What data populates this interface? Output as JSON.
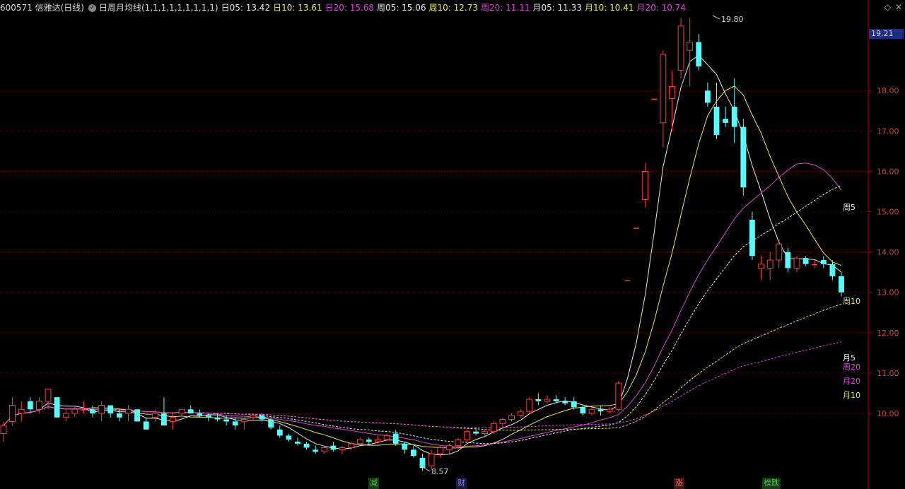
{
  "header": {
    "stock": "600571 信雅达(日线)",
    "indicator": "日周月均线(1,1,1,1,1,1,1,1,1)",
    "values": [
      {
        "label": "日05: 13.42",
        "color": "#e8e8e8"
      },
      {
        "label": "日10: 13.61",
        "color": "#e8e850"
      },
      {
        "label": "日20: 15.68",
        "color": "#e040e0"
      },
      {
        "label": "周05: 15.06",
        "color": "#e8e8e8"
      },
      {
        "label": "周10: 12.73",
        "color": "#e8e850"
      },
      {
        "label": "周20: 11.11",
        "color": "#e040e0"
      },
      {
        "label": "月05: 11.33",
        "color": "#e8e8e8"
      },
      {
        "label": "月10: 10.41",
        "color": "#e8e850"
      },
      {
        "label": "月20: 10.74",
        "color": "#e040e0"
      }
    ]
  },
  "window_icons": [
    "diamond-icon",
    "close-icon"
  ],
  "price_axis": {
    "ticks": [
      "18.00",
      "17.00",
      "16.00",
      "15.00",
      "14.00",
      "13.00",
      "12.00",
      "11.00",
      "10.00"
    ],
    "current_price": "19.21"
  },
  "annotations": {
    "high": "19.80",
    "low": "8.57"
  },
  "legend": [
    {
      "label": "周5",
      "color": "#e8e8e8"
    },
    {
      "label": "周10",
      "color": "#e8e850"
    },
    {
      "label": "月5",
      "color": "#e8e8e8"
    },
    {
      "label": "周20",
      "color": "#e040e0"
    },
    {
      "label": "月20",
      "color": "#e040e0"
    },
    {
      "label": "月10",
      "color": "#e8e850"
    }
  ],
  "events": [
    {
      "label": "减",
      "color": "#3cc83c",
      "bg": "#1a3a1a"
    },
    {
      "label": "财",
      "color": "#8080ff",
      "bg": "#1a1a40"
    },
    {
      "label": "涨",
      "color": "#ff6060",
      "bg": "#401818"
    },
    {
      "label": "榜跌",
      "color": "#3cc83c",
      "bg": "#1a3a1a"
    }
  ],
  "colors": {
    "up": "#ff3c3c",
    "down": "#54ffff",
    "grid": "#8c0000",
    "axis": "#b00000"
  },
  "chart_data": {
    "type": "candlestick",
    "y_range": [
      8.2,
      20.0
    ],
    "daily_ohlc_approx": [
      {
        "o": 9.5,
        "h": 9.8,
        "l": 9.3,
        "c": 9.7
      },
      {
        "o": 9.8,
        "h": 10.4,
        "l": 9.7,
        "c": 10.2
      },
      {
        "o": 10.0,
        "h": 10.3,
        "l": 9.8,
        "c": 10.1
      },
      {
        "o": 10.3,
        "h": 10.4,
        "l": 10.0,
        "c": 10.1
      },
      {
        "o": 10.1,
        "h": 10.4,
        "l": 10.0,
        "c": 10.3
      },
      {
        "o": 10.3,
        "h": 10.6,
        "l": 10.1,
        "c": 10.6
      },
      {
        "o": 10.4,
        "h": 10.4,
        "l": 9.9,
        "c": 9.9
      },
      {
        "o": 9.9,
        "h": 10.1,
        "l": 9.8,
        "c": 10.0
      },
      {
        "o": 10.0,
        "h": 10.2,
        "l": 9.9,
        "c": 10.1
      },
      {
        "o": 10.1,
        "h": 10.3,
        "l": 10.0,
        "c": 10.1
      },
      {
        "o": 10.1,
        "h": 10.2,
        "l": 9.9,
        "c": 10.0
      },
      {
        "o": 10.0,
        "h": 10.3,
        "l": 9.8,
        "c": 10.2
      },
      {
        "o": 10.2,
        "h": 10.2,
        "l": 9.9,
        "c": 10.0
      },
      {
        "o": 10.0,
        "h": 10.1,
        "l": 9.8,
        "c": 9.9
      },
      {
        "o": 10.0,
        "h": 10.2,
        "l": 9.8,
        "c": 10.1
      },
      {
        "o": 10.1,
        "h": 10.1,
        "l": 9.8,
        "c": 9.8
      },
      {
        "o": 9.8,
        "h": 9.9,
        "l": 9.6,
        "c": 9.6
      },
      {
        "o": 9.9,
        "h": 10.1,
        "l": 9.8,
        "c": 10.0
      },
      {
        "o": 10.0,
        "h": 10.4,
        "l": 9.8,
        "c": 9.7
      },
      {
        "o": 9.8,
        "h": 10.0,
        "l": 9.6,
        "c": 9.9
      },
      {
        "o": 10.0,
        "h": 10.1,
        "l": 9.9,
        "c": 10.1
      },
      {
        "o": 10.1,
        "h": 10.2,
        "l": 10.0,
        "c": 10.0
      },
      {
        "o": 10.0,
        "h": 10.1,
        "l": 9.9,
        "c": 9.95
      },
      {
        "o": 9.95,
        "h": 10.0,
        "l": 9.8,
        "c": 9.9
      },
      {
        "o": 9.9,
        "h": 10.0,
        "l": 9.8,
        "c": 9.85
      },
      {
        "o": 9.85,
        "h": 9.95,
        "l": 9.7,
        "c": 9.8
      },
      {
        "o": 9.8,
        "h": 9.9,
        "l": 9.6,
        "c": 9.7
      },
      {
        "o": 9.8,
        "h": 9.9,
        "l": 9.6,
        "c": 9.85
      },
      {
        "o": 9.9,
        "h": 10.0,
        "l": 9.8,
        "c": 9.95
      },
      {
        "o": 9.95,
        "h": 10.0,
        "l": 9.8,
        "c": 9.85
      },
      {
        "o": 9.85,
        "h": 9.9,
        "l": 9.6,
        "c": 9.65
      },
      {
        "o": 9.6,
        "h": 9.7,
        "l": 9.4,
        "c": 9.45
      },
      {
        "o": 9.45,
        "h": 9.5,
        "l": 9.3,
        "c": 9.35
      },
      {
        "o": 9.3,
        "h": 9.4,
        "l": 9.2,
        "c": 9.25
      },
      {
        "o": 9.25,
        "h": 9.3,
        "l": 9.1,
        "c": 9.15
      },
      {
        "o": 9.1,
        "h": 9.2,
        "l": 9.0,
        "c": 9.05
      },
      {
        "o": 9.05,
        "h": 9.2,
        "l": 9.0,
        "c": 9.15
      },
      {
        "o": 9.2,
        "h": 9.3,
        "l": 9.05,
        "c": 9.1
      },
      {
        "o": 9.1,
        "h": 9.2,
        "l": 9.0,
        "c": 9.15
      },
      {
        "o": 9.15,
        "h": 9.3,
        "l": 9.1,
        "c": 9.25
      },
      {
        "o": 9.25,
        "h": 9.4,
        "l": 9.2,
        "c": 9.35
      },
      {
        "o": 9.35,
        "h": 9.4,
        "l": 9.2,
        "c": 9.3
      },
      {
        "o": 9.3,
        "h": 9.45,
        "l": 9.25,
        "c": 9.35
      },
      {
        "o": 9.35,
        "h": 9.5,
        "l": 9.3,
        "c": 9.45
      },
      {
        "o": 9.5,
        "h": 9.6,
        "l": 9.2,
        "c": 9.25
      },
      {
        "o": 9.25,
        "h": 9.3,
        "l": 9.0,
        "c": 9.1
      },
      {
        "o": 9.1,
        "h": 9.2,
        "l": 8.9,
        "c": 8.95
      },
      {
        "o": 8.9,
        "h": 9.0,
        "l": 8.57,
        "c": 8.65
      },
      {
        "o": 8.7,
        "h": 9.1,
        "l": 8.6,
        "c": 9.0
      },
      {
        "o": 9.0,
        "h": 9.2,
        "l": 8.9,
        "c": 9.15
      },
      {
        "o": 9.1,
        "h": 9.25,
        "l": 9.0,
        "c": 9.2
      },
      {
        "o": 9.2,
        "h": 9.4,
        "l": 9.1,
        "c": 9.35
      },
      {
        "o": 9.35,
        "h": 9.6,
        "l": 9.3,
        "c": 9.55
      },
      {
        "o": 9.55,
        "h": 9.65,
        "l": 9.45,
        "c": 9.5
      },
      {
        "o": 9.5,
        "h": 9.6,
        "l": 9.4,
        "c": 9.55
      },
      {
        "o": 9.55,
        "h": 9.8,
        "l": 9.5,
        "c": 9.75
      },
      {
        "o": 9.75,
        "h": 9.9,
        "l": 9.65,
        "c": 9.85
      },
      {
        "o": 9.85,
        "h": 10.0,
        "l": 9.8,
        "c": 9.95
      },
      {
        "o": 9.95,
        "h": 10.1,
        "l": 9.9,
        "c": 10.05
      },
      {
        "o": 10.05,
        "h": 10.4,
        "l": 10.0,
        "c": 10.35
      },
      {
        "o": 10.35,
        "h": 10.5,
        "l": 10.2,
        "c": 10.3
      },
      {
        "o": 10.3,
        "h": 10.45,
        "l": 10.25,
        "c": 10.35
      },
      {
        "o": 10.35,
        "h": 10.45,
        "l": 10.25,
        "c": 10.3
      },
      {
        "o": 10.3,
        "h": 10.4,
        "l": 10.2,
        "c": 10.25
      },
      {
        "o": 10.3,
        "h": 10.4,
        "l": 10.1,
        "c": 10.15
      },
      {
        "o": 10.15,
        "h": 10.2,
        "l": 9.95,
        "c": 10.0
      },
      {
        "o": 10.0,
        "h": 10.15,
        "l": 9.95,
        "c": 10.1
      },
      {
        "o": 10.1,
        "h": 10.2,
        "l": 9.95,
        "c": 10.05
      },
      {
        "o": 10.05,
        "h": 10.15,
        "l": 10.0,
        "c": 10.1
      },
      {
        "o": 10.1,
        "h": 10.8,
        "l": 10.05,
        "c": 10.75
      },
      {
        "o": 13.3,
        "h": 13.3,
        "l": 13.3,
        "c": 13.3
      },
      {
        "o": 14.6,
        "h": 14.6,
        "l": 14.6,
        "c": 14.6
      },
      {
        "o": 15.3,
        "h": 16.2,
        "l": 15.1,
        "c": 16.0
      },
      {
        "o": 17.8,
        "h": 17.8,
        "l": 17.8,
        "c": 17.8
      },
      {
        "o": 17.2,
        "h": 19.0,
        "l": 16.6,
        "c": 18.9
      },
      {
        "o": 17.8,
        "h": 18.5,
        "l": 17.0,
        "c": 18.1
      },
      {
        "o": 18.5,
        "h": 19.8,
        "l": 18.3,
        "c": 19.6
      },
      {
        "o": 19.0,
        "h": 19.8,
        "l": 18.1,
        "c": 19.2
      },
      {
        "o": 19.2,
        "h": 19.4,
        "l": 18.5,
        "c": 18.6
      },
      {
        "o": 18.0,
        "h": 18.2,
        "l": 17.6,
        "c": 17.7
      },
      {
        "o": 17.6,
        "h": 18.2,
        "l": 16.8,
        "c": 16.9
      },
      {
        "o": 17.3,
        "h": 17.6,
        "l": 17.1,
        "c": 17.2
      },
      {
        "o": 17.6,
        "h": 18.3,
        "l": 16.7,
        "c": 17.1
      },
      {
        "o": 17.1,
        "h": 17.3,
        "l": 15.4,
        "c": 15.6
      },
      {
        "o": 14.8,
        "h": 15.0,
        "l": 13.8,
        "c": 13.9
      },
      {
        "o": 13.6,
        "h": 13.9,
        "l": 13.3,
        "c": 13.7
      },
      {
        "o": 13.6,
        "h": 14.0,
        "l": 13.3,
        "c": 13.8
      },
      {
        "o": 13.8,
        "h": 14.3,
        "l": 13.6,
        "c": 14.2
      },
      {
        "o": 14.0,
        "h": 14.1,
        "l": 13.5,
        "c": 13.6
      },
      {
        "o": 13.6,
        "h": 13.9,
        "l": 13.5,
        "c": 13.85
      },
      {
        "o": 13.85,
        "h": 13.9,
        "l": 13.65,
        "c": 13.7
      },
      {
        "o": 13.7,
        "h": 13.8,
        "l": 13.6,
        "c": 13.7
      },
      {
        "o": 13.8,
        "h": 13.9,
        "l": 13.6,
        "c": 13.7
      },
      {
        "o": 13.7,
        "h": 13.8,
        "l": 13.3,
        "c": 13.4
      },
      {
        "o": 13.4,
        "h": 13.5,
        "l": 12.9,
        "c": 13.0
      }
    ]
  }
}
